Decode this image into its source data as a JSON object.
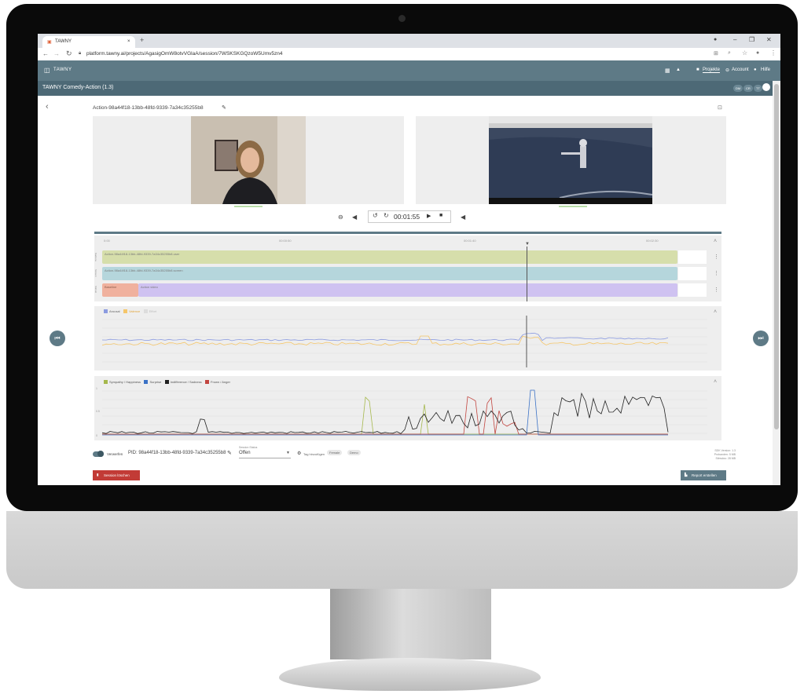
{
  "browser": {
    "tab_title": "TAWNY",
    "tab_close": "×",
    "new_tab": "+",
    "url": "platform.tawny.ai/projects/AgasigOmW8otvVGlaA/session/7WSKSKGQzoW5Umv5zn4",
    "window_controls": [
      "–",
      "❐",
      "✕"
    ]
  },
  "app": {
    "logo_text": "TAWNY",
    "nav": {
      "projects": "Projekte",
      "account": "Account",
      "help": "Hilfe"
    },
    "project_title": "TAWNY Comedy-Action (1.3)",
    "badges": [
      "DM",
      "CR",
      "TT"
    ]
  },
  "session": {
    "title": "Action-98a44f18-13bb-48fd-9339-7a34c35255b8",
    "playback_time": "00:01:55",
    "tracks": [
      {
        "label": "Action-98a44f18-13bb-48fd-9339-7a34c35255b8.user",
        "side": "Kamera",
        "color": "#d6deab"
      },
      {
        "label": "Action-98a44f18-13bb-48fd-9339-7a34c35255b8.screen",
        "side": "Screen",
        "color": "#b5d6dc"
      },
      {
        "label": "Action video",
        "side": "Stimuli",
        "color": "#cfc2f1",
        "pre_label": "Baseline",
        "pre_color": "#f0b19e"
      }
    ],
    "time_ticks": [
      "0:00",
      "00:00:50",
      "00:01:40",
      "00:02:30"
    ],
    "chart1_legend": [
      {
        "name": "Arousal",
        "color": "#8b9be0"
      },
      {
        "name": "Valence",
        "color": "#f5c66a"
      },
      {
        "name": "Effort",
        "color": "#cccccc"
      }
    ],
    "chart2_legend": [
      {
        "name": "Sympathy / Happiness",
        "color": "#a5b84c"
      },
      {
        "name": "Surprise",
        "color": "#3b72c6"
      },
      {
        "name": "Indifference / Sadness",
        "color": "#222222"
      },
      {
        "name": "Frown / Anger",
        "color": "#c2453f"
      }
    ],
    "chart2_yticks": [
      "1",
      "0.5",
      "0"
    ],
    "footer": {
      "toggle_label": "Verwerfen",
      "pid": "PID: 98a44f18-13bb-48fd-9339-7a34c35255b8",
      "status_label": "Session Status",
      "status_value": "Offen",
      "tag_add": "Tag hinzufügen",
      "tags": [
        "Female",
        "Demo"
      ],
      "info_lines": [
        "SDK Version: 1.3",
        "Probanden: 5 MB",
        "Stimulus: 28 MB"
      ],
      "delete_button": "Session löschen",
      "report_button": "Report erstellen"
    }
  },
  "colors": {
    "appbar": "#5e7a86",
    "subbar": "#4d6976",
    "delete": "#c23b36"
  }
}
